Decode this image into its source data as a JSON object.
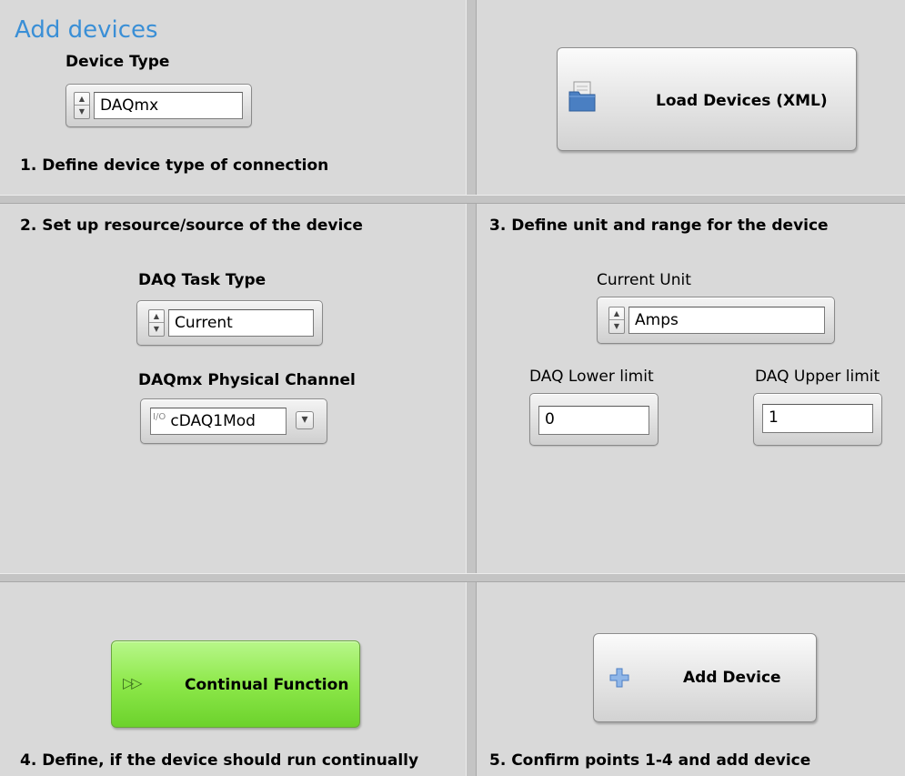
{
  "title": "Add devices",
  "quadrant1": {
    "device_type_label": "Device Type",
    "device_type_value": "DAQmx",
    "step_text": "1. Define device type of connection",
    "load_button_label": "Load Devices (XML)"
  },
  "quadrant2": {
    "step_text": "2. Set up resource/source of the device",
    "task_type_label": "DAQ Task Type",
    "task_type_value": "Current",
    "channel_label": "DAQmx Physical Channel",
    "channel_value": "cDAQ1Mod"
  },
  "quadrant3": {
    "step_text": "3. Define unit and range for the device",
    "unit_label": "Current Unit",
    "unit_value": "Amps",
    "lower_label": "DAQ Lower limit",
    "lower_value": "0",
    "upper_label": "DAQ Upper limit",
    "upper_value": "1"
  },
  "quadrant4": {
    "button_label": "Continual Function",
    "step_text": "4. Define, if the device should run continually"
  },
  "quadrant5": {
    "button_label": "Add Device",
    "step_text": "5. Confirm points 1-4 and add device"
  },
  "icons": {
    "spinner_up": "▲",
    "spinner_down": "▼",
    "dropdown": "▾",
    "continual": "▷▷",
    "folder": "folder-icon",
    "plus": "plus-icon",
    "io": "io-channel-icon"
  },
  "colors": {
    "title_blue": "#3a8fd6",
    "button_green": "#8de84a"
  }
}
